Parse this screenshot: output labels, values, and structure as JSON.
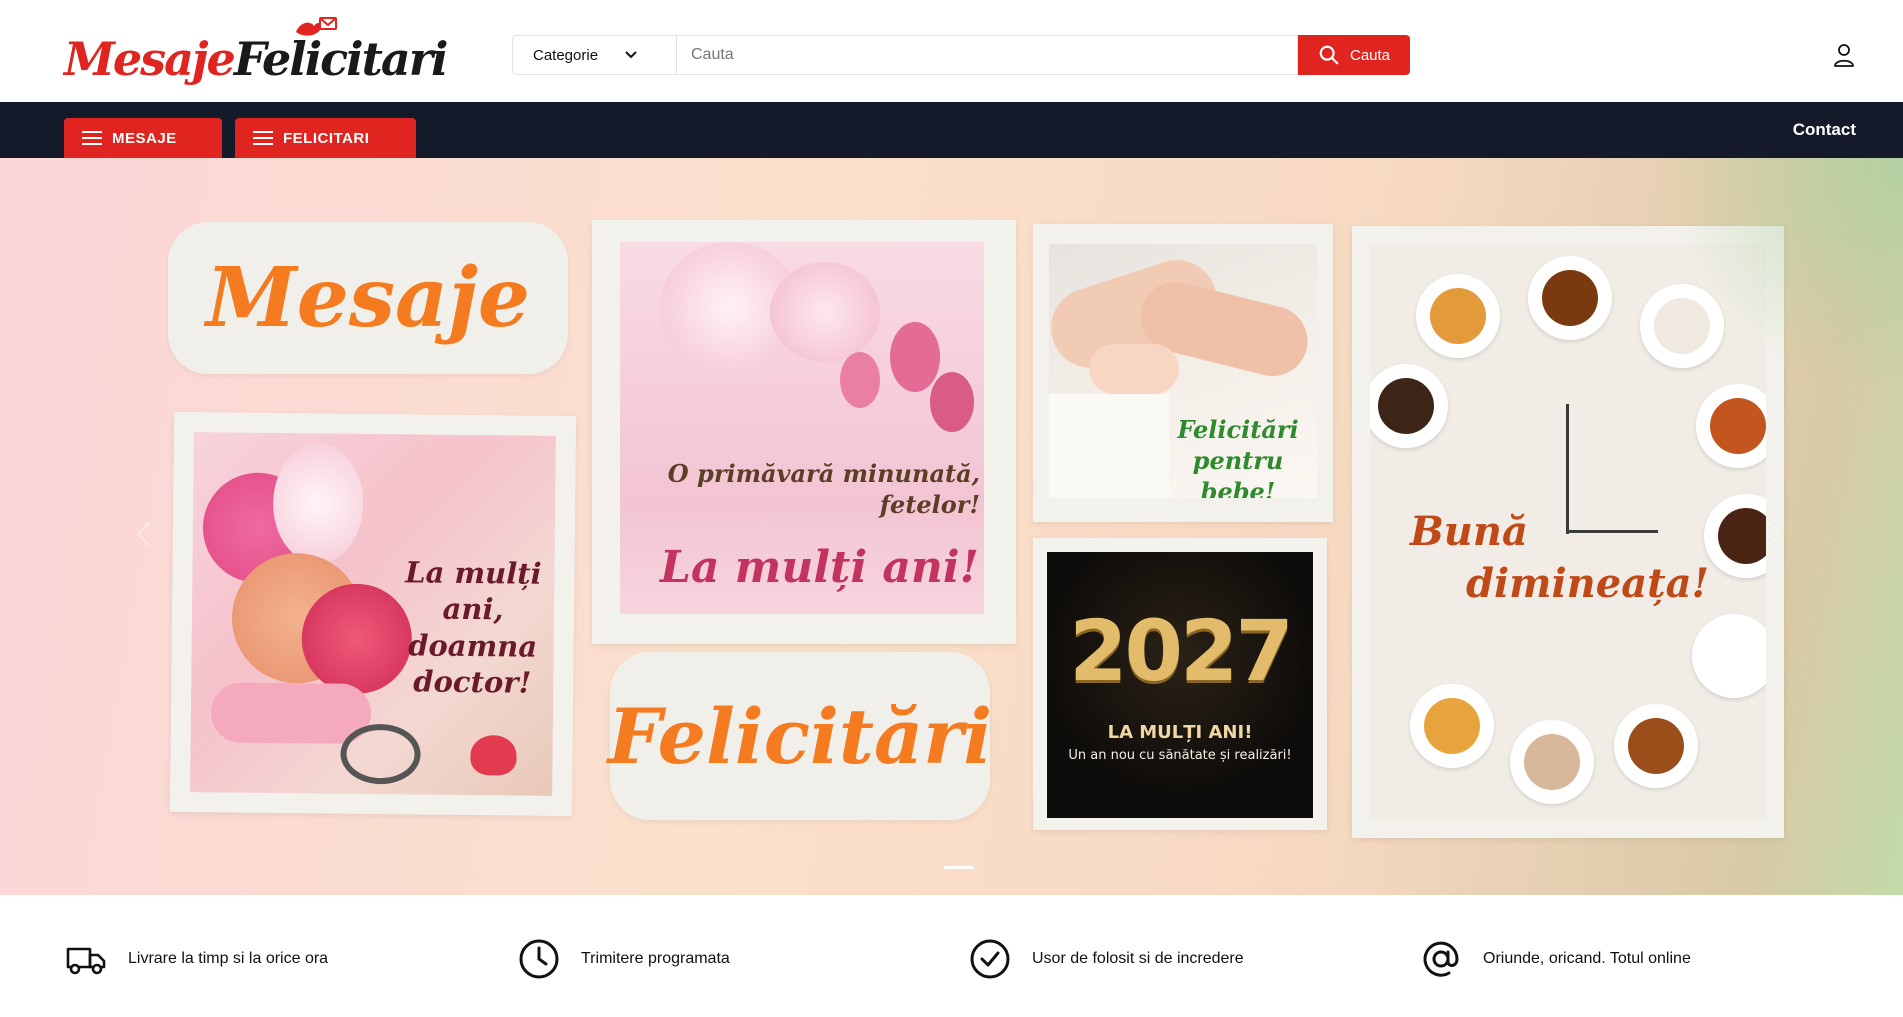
{
  "header": {
    "logo": {
      "part1": "Mesaje",
      "part2": "Felicitari"
    },
    "search": {
      "category_label": "Categorie",
      "placeholder": "Cauta",
      "button_label": "Cauta"
    }
  },
  "nav": {
    "mesaje_label": "MESAJE",
    "felicitari_label": "FELICITARI",
    "contact_label": "Contact"
  },
  "hero": {
    "pill_mesaje": "Mesaje",
    "pill_felicitari": "Felicitări",
    "card_flowers": {
      "line1": "La mulți ani,",
      "line2": "doamna",
      "line3": "doctor!"
    },
    "card_blossom": {
      "line1": "O primăvară minunată,",
      "line2": "fetelor!",
      "line3": "La mulți ani!"
    },
    "card_baby": {
      "line1": "Felicitări",
      "line2": "pentru bebe!"
    },
    "card_newyear": {
      "year": "2027",
      "line1": "LA MULȚI ANI!",
      "line2": "Un an nou cu sănătate și realizări!"
    },
    "card_coffee": {
      "line1": "Bună",
      "line2": "dimineața!"
    }
  },
  "features": [
    {
      "icon": "truck-icon",
      "label": "Livrare la timp si la orice ora"
    },
    {
      "icon": "clock-icon",
      "label": "Trimitere programata"
    },
    {
      "icon": "check-circle-icon",
      "label": "Usor de folosit si de incredere"
    },
    {
      "icon": "at-sign-icon",
      "label": "Oriunde, oricand. Totul online"
    }
  ],
  "colors": {
    "brand_red": "#e0241f",
    "nav_dark": "#141a29",
    "pill_orange": "#f47b20"
  }
}
